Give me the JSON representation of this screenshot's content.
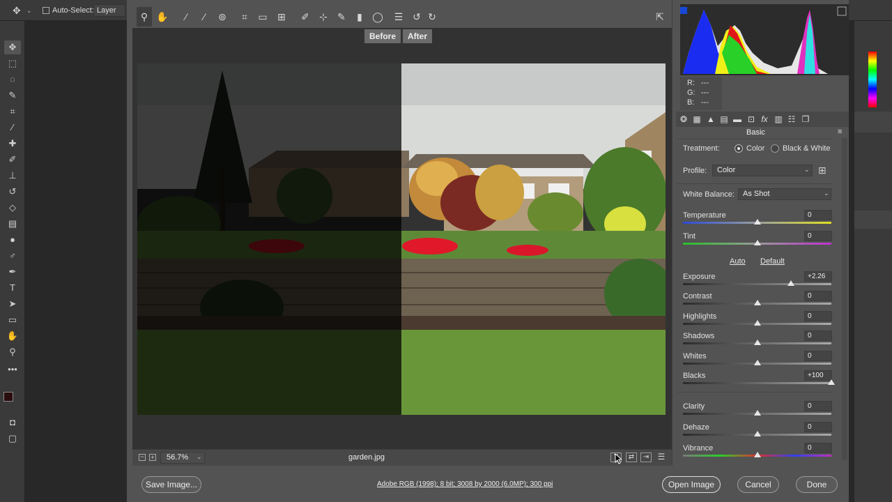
{
  "ps": {
    "options": {
      "autoselect_label": "Auto-Select:",
      "layer_value": "Layer"
    },
    "tools": [
      "move-icon",
      "marquee-icon",
      "lasso-icon",
      "quick-select-icon",
      "crop-icon",
      "eyedropper-icon",
      "healing-icon",
      "brush-icon",
      "stamp-icon",
      "history-brush-icon",
      "eraser-icon",
      "gradient-icon",
      "blur-icon",
      "dodge-icon",
      "pen-icon",
      "type-icon",
      "path-select-icon",
      "rectangle-icon",
      "hand-icon",
      "zoom-icon",
      "more-icon",
      "swap-colors-icon"
    ],
    "colors": {
      "foreground": "#2a0d0d",
      "background": "#000000",
      "ui": "#3a3a3a"
    }
  },
  "acr": {
    "toolbar_icons": [
      "zoom-icon",
      "hand-icon",
      "white-balance-icon",
      "color-sampler-icon",
      "targeted-adjust-icon",
      "crop-icon",
      "straighten-icon",
      "transform-icon",
      "spot-removal-icon",
      "red-eye-icon",
      "adjustment-brush-icon",
      "graduated-filter-icon",
      "radial-filter-icon",
      "presets-icon",
      "rotate-left-icon",
      "rotate-right-icon",
      "fullscreen-icon"
    ],
    "before_label": "Before",
    "after_label": "After",
    "zoom_value": "56.7%",
    "filename": "garden.jpg",
    "save_label": "Save Image...",
    "workflow_link": "Adobe RGB (1998); 8 bit; 3008 by 2000 (6.0MP); 300 ppi",
    "open_label": "Open Image",
    "cancel_label": "Cancel",
    "done_label": "Done"
  },
  "panel": {
    "rgb": {
      "r": "R:",
      "r_val": "---",
      "g": "G:",
      "g_val": "---",
      "b": "B:",
      "b_val": "---"
    },
    "title": "Basic",
    "treatment_label": "Treatment:",
    "treatment_color": "Color",
    "treatment_bw": "Black & White",
    "profile_label": "Profile:",
    "profile_value": "Color",
    "wb_label": "White Balance:",
    "wb_value": "As Shot",
    "auto_link": "Auto",
    "default_link": "Default",
    "sliders": [
      {
        "name": "Temperature",
        "value": "0",
        "pos": 0.5
      },
      {
        "name": "Tint",
        "value": "0",
        "pos": 0.5
      },
      {
        "name": "Exposure",
        "value": "+2.26",
        "pos": 0.726
      },
      {
        "name": "Contrast",
        "value": "0",
        "pos": 0.5
      },
      {
        "name": "Highlights",
        "value": "0",
        "pos": 0.5
      },
      {
        "name": "Shadows",
        "value": "0",
        "pos": 0.5
      },
      {
        "name": "Whites",
        "value": "0",
        "pos": 0.5
      },
      {
        "name": "Blacks",
        "value": "+100",
        "pos": 1.0
      },
      {
        "name": "Clarity",
        "value": "0",
        "pos": 0.5
      },
      {
        "name": "Dehaze",
        "value": "0",
        "pos": 0.5
      },
      {
        "name": "Vibrance",
        "value": "0",
        "pos": 0.5
      }
    ]
  }
}
